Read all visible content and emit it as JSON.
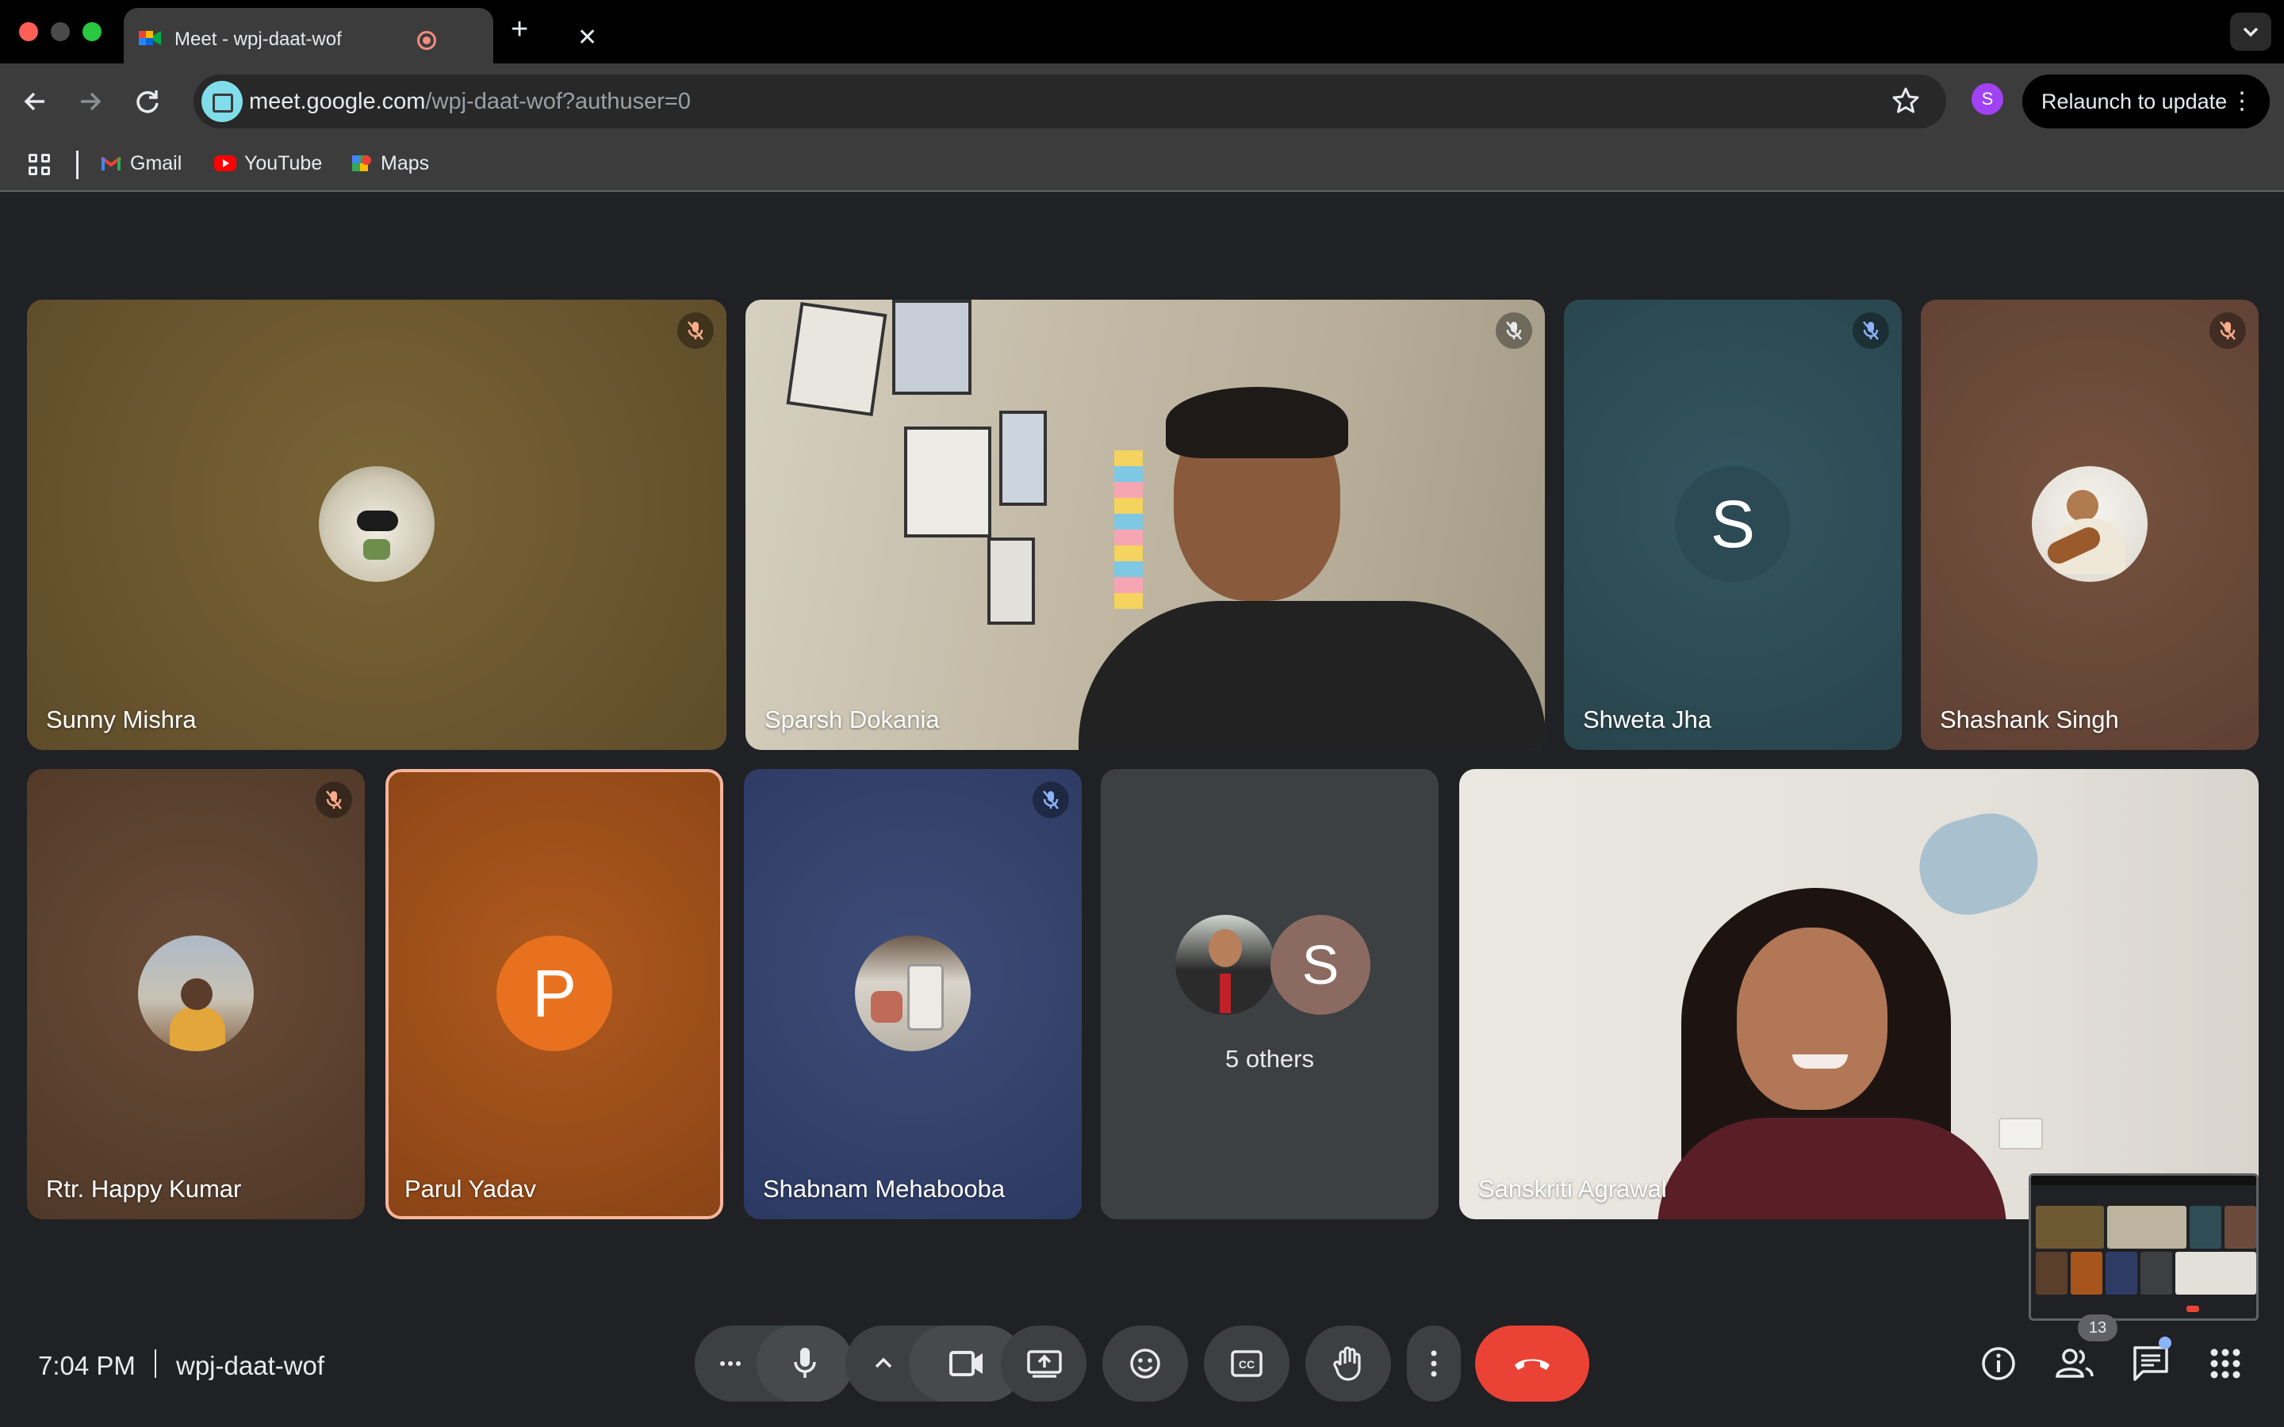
{
  "browser": {
    "tab": {
      "title": "Meet - wpj-daat-wof"
    },
    "address": {
      "host": "meet.google.com",
      "path": "/wpj-daat-wof?authuser=0"
    },
    "profile_initial": "S",
    "relaunch_label": "Relaunch to update",
    "bookmarks": [
      {
        "label": "Gmail",
        "icon": "gmail-icon"
      },
      {
        "label": "YouTube",
        "icon": "youtube-icon"
      },
      {
        "label": "Maps",
        "icon": "maps-icon"
      }
    ]
  },
  "meet": {
    "participants": [
      {
        "name": "Sunny Mishra",
        "muted": true,
        "type": "avatar-photo",
        "bg": "#6e5a32"
      },
      {
        "name": "Sparsh Dokania",
        "muted": true,
        "type": "video",
        "bg": "#c9c2b0"
      },
      {
        "name": "Shweta Jha",
        "muted": true,
        "type": "letter",
        "initial": "S",
        "bg": "#2f4d55"
      },
      {
        "name": "Shashank Singh",
        "muted": true,
        "type": "avatar-photo",
        "bg": "#6b4a3c"
      },
      {
        "name": "Rtr. Happy Kumar",
        "muted": true,
        "type": "avatar-photo",
        "bg": "#5a3f2c"
      },
      {
        "name": "Parul Yadav",
        "muted": false,
        "type": "letter",
        "initial": "P",
        "bg": "#a8551c",
        "speaking": true
      },
      {
        "name": "Shabnam Mehabooba",
        "muted": true,
        "type": "avatar-photo",
        "bg": "#2f3d66"
      },
      {
        "name": "5 others",
        "type": "group",
        "initial": "S"
      },
      {
        "name": "Sanskriti Agrawal",
        "muted": false,
        "type": "video",
        "bg": "#e6e3dc"
      }
    ],
    "footer": {
      "time": "7:04 PM",
      "meeting_code": "wpj-daat-wof",
      "people_count": "13"
    }
  },
  "colors": {
    "end_call": "#ea4335",
    "speaking_border": "#f6b59b",
    "control_bg": "#3c4043"
  }
}
